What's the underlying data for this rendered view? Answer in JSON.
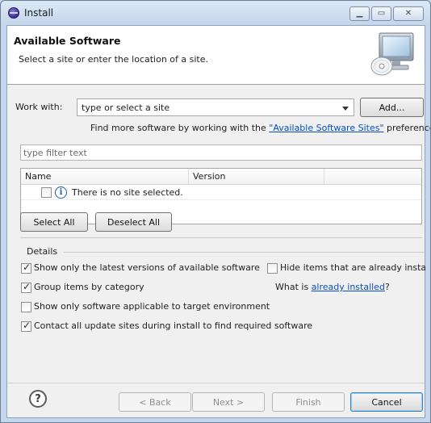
{
  "window": {
    "title": "Install",
    "minimize_icon": "minimize-icon",
    "maximize_icon": "maximize-icon",
    "close_icon": "close-icon"
  },
  "header": {
    "title": "Available Software",
    "subtitle": "Select a site or enter the location of a site.",
    "image_icon": "monitor-cd-icon"
  },
  "work_with": {
    "label": "Work with:",
    "value": "type or select a site",
    "add_label": "Add...",
    "find_prefix": "Find more software by working with the ",
    "find_link": "\"Available Software Sites\"",
    "find_suffix": " preferences."
  },
  "filter": {
    "placeholder": "type filter text"
  },
  "table": {
    "columns": [
      "Name",
      "Version"
    ],
    "rows": [
      {
        "checked": false,
        "icon": "info-icon",
        "text": "There is no site selected."
      }
    ]
  },
  "selection_buttons": {
    "select_all": "Select All",
    "deselect_all": "Deselect All"
  },
  "details": {
    "label": "Details",
    "options": [
      {
        "label": "Show only the latest versions of available software",
        "checked": true
      },
      {
        "label": "Hide items that are already installed",
        "checked": false
      },
      {
        "label": "Group items by category",
        "checked": true
      },
      {
        "label": "Show only software applicable to target environment",
        "checked": false
      },
      {
        "label": "Contact all update sites during install to find required software",
        "checked": true
      }
    ],
    "what_is_prefix": "What is ",
    "what_is_link": "already installed",
    "what_is_suffix": "?"
  },
  "footer": {
    "help_icon": "help-icon",
    "back": "< Back",
    "next": "Next >",
    "finish": "Finish",
    "cancel": "Cancel"
  }
}
